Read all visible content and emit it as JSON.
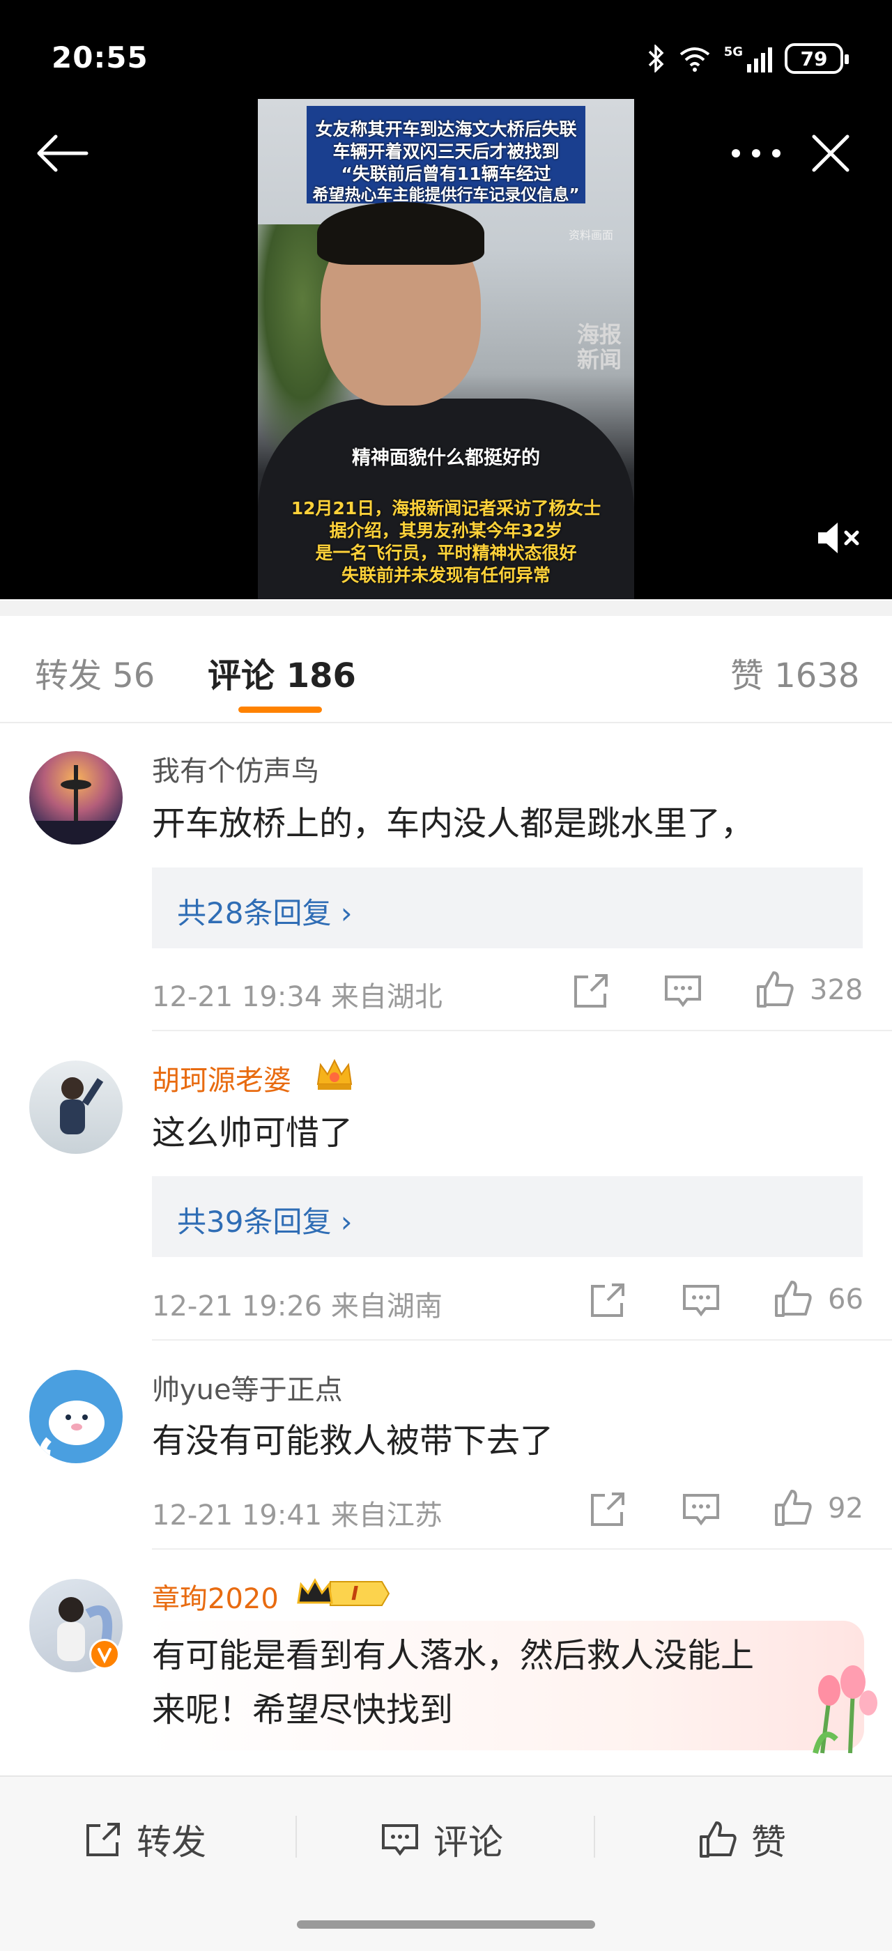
{
  "status_bar": {
    "time": "20:55",
    "battery": "79",
    "network": "5G"
  },
  "video": {
    "caption_lines": [
      "女友称其开车到达海文大桥后失联",
      "车辆开着双闪三天后才被找到"
    ],
    "quote_lines": [
      "“失联前后曾有11辆车经过",
      "希望热心车主能提供行车记录仪信息”"
    ],
    "source_note": "资料画面",
    "watermark": [
      "海报",
      "新闻"
    ],
    "subtitle": "精神面貌什么都挺好的",
    "bottom_lines": [
      "12月21日，海报新闻记者采访了杨女士",
      "据介绍，其男友孙某今年32岁",
      "是一名飞行员，平时精神状态很好",
      "失联前并未发现有任何异常"
    ]
  },
  "tabs": {
    "repost": "转发 56",
    "comments": "评论 186",
    "likes": "赞 1638"
  },
  "comments": [
    {
      "username": "我有个仿声鸟",
      "text": "开车放桥上的，车内没人都是跳水里了，",
      "replies": "共28条回复 ›",
      "meta": "12-21 19:34 来自湖北",
      "likes": "328"
    },
    {
      "username": "胡珂源老婆",
      "text": "这么帅可惜了",
      "replies": "共39条回复 ›",
      "meta": "12-21 19:26 来自湖南",
      "likes": "66"
    },
    {
      "username": "帅yue等于正点",
      "text": "有没有可能救人被带下去了",
      "meta": "12-21 19:41 来自江苏",
      "likes": "92"
    },
    {
      "username": "章珣2020",
      "badge_level": "I",
      "text_line1": "有可能是看到有人落水，然后救人没能上",
      "text_line2": "来呢！希望尽快找到"
    }
  ],
  "bottom_bar": {
    "repost": "转发",
    "comment": "评论",
    "like": "赞"
  },
  "colors": {
    "accent": "#ff8200",
    "link": "#2f6db5",
    "vip_name": "#e86b10"
  }
}
